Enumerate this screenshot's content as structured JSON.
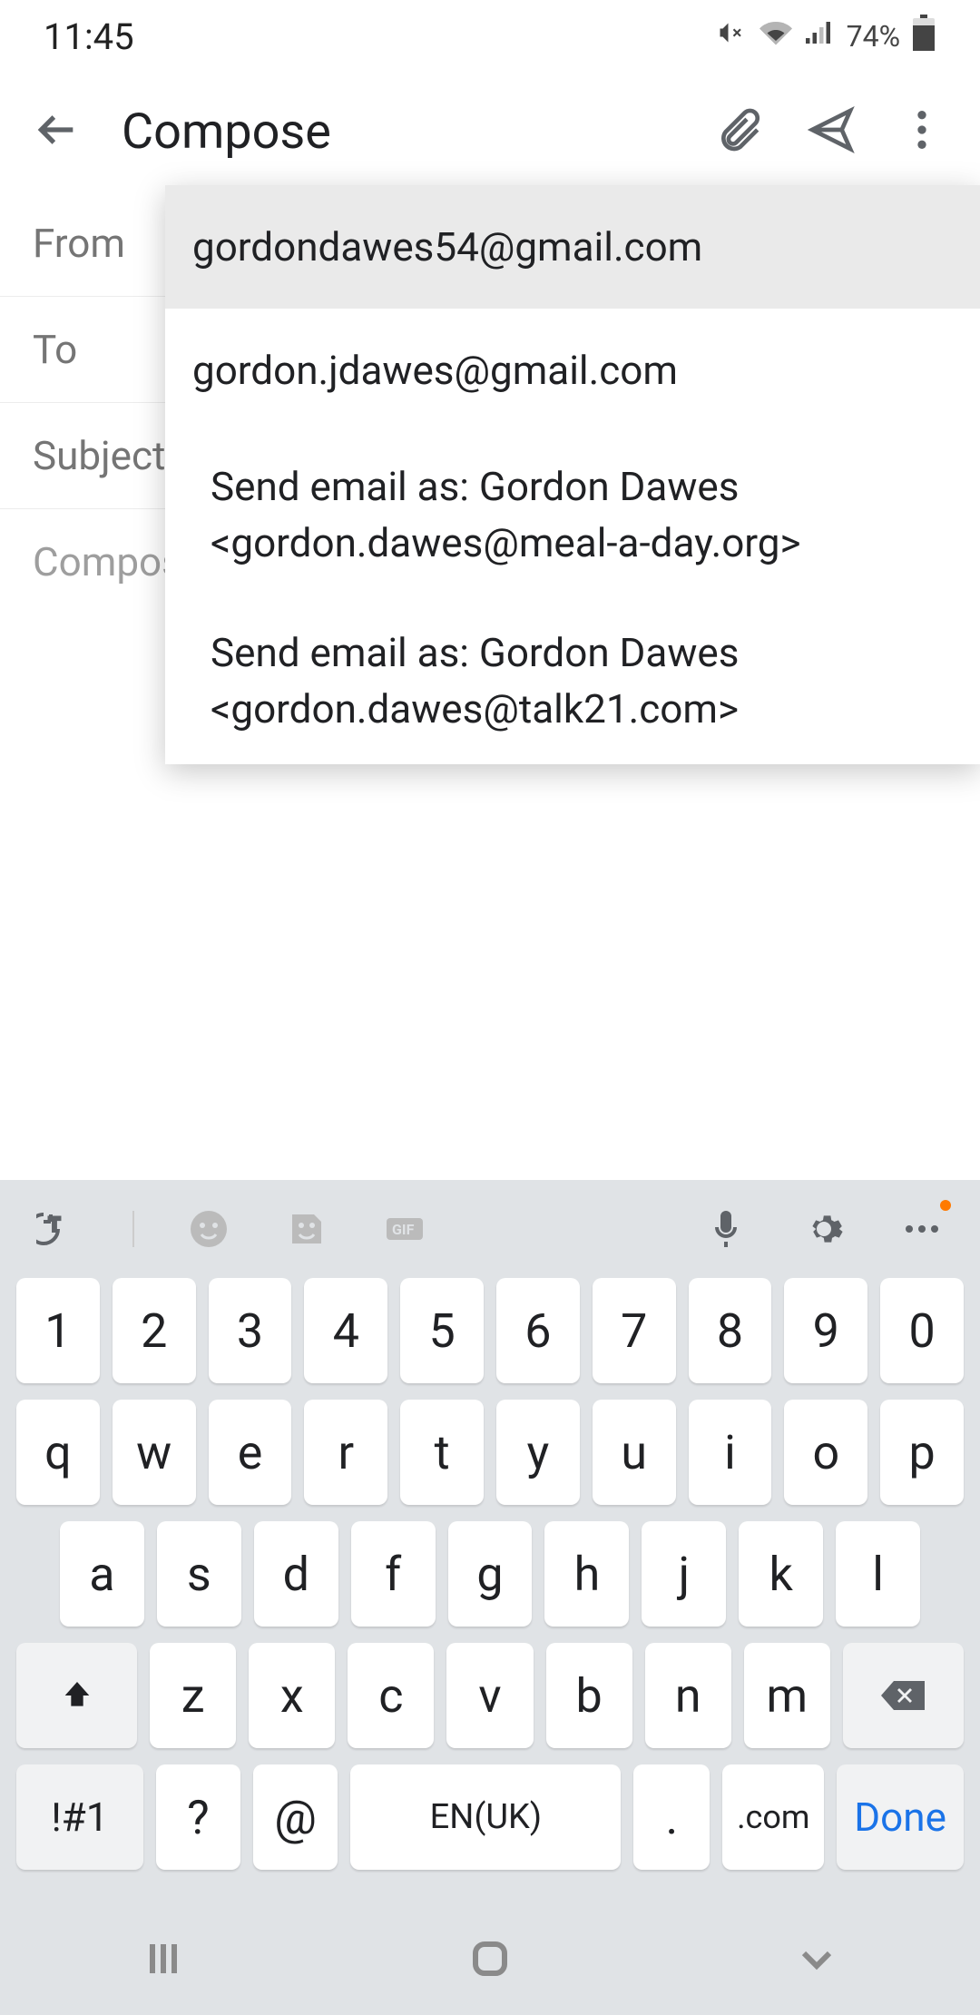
{
  "status": {
    "time": "11:45",
    "battery": "74%"
  },
  "appbar": {
    "title": "Compose"
  },
  "fields": {
    "from_label": "From",
    "to_label": "To",
    "subject_label": "Subject",
    "body_placeholder": "Compose email"
  },
  "dropdown": {
    "option1": "gordondawes54@gmail.com",
    "option2": "gordon.jdawes@gmail.com",
    "option3_line1": "Send email as:  Gordon Dawes",
    "option3_line2": "<gordon.dawes@meal-a-day.org>",
    "option4_line1": "Send email as:  Gordon Dawes",
    "option4_line2": "<gordon.dawes@talk21.com>"
  },
  "keyboard": {
    "row1": [
      "1",
      "2",
      "3",
      "4",
      "5",
      "6",
      "7",
      "8",
      "9",
      "0"
    ],
    "row2": [
      "q",
      "w",
      "e",
      "r",
      "t",
      "y",
      "u",
      "i",
      "o",
      "p"
    ],
    "row3": [
      "a",
      "s",
      "d",
      "f",
      "g",
      "h",
      "j",
      "k",
      "l"
    ],
    "row4": [
      "z",
      "x",
      "c",
      "v",
      "b",
      "n",
      "m"
    ],
    "sym": "!#1",
    "qmark": "?",
    "at": "@",
    "space": "EN(UK)",
    "dot": ".",
    "com": ".com",
    "done": "Done"
  }
}
